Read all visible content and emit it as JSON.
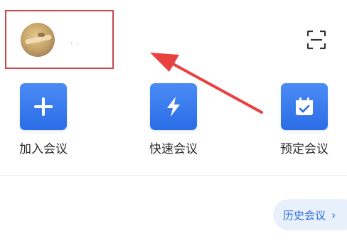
{
  "profile": {
    "name_masked": ". .",
    "avatar_icon": "user-avatar-photo"
  },
  "toolbar": {
    "scan_icon": "scan-icon"
  },
  "actions": [
    {
      "label": "加入会议",
      "icon": "plus-icon"
    },
    {
      "label": "快速会议",
      "icon": "lightning-icon"
    },
    {
      "label": "预定会议",
      "icon": "calendar-check-icon"
    }
  ],
  "history": {
    "label": "历史会议",
    "chevron": "›"
  },
  "colors": {
    "accent": "#2a6de6",
    "highlight": "#c9494b",
    "arrow": "#e8413f",
    "history_bg": "#e8f0fc"
  }
}
